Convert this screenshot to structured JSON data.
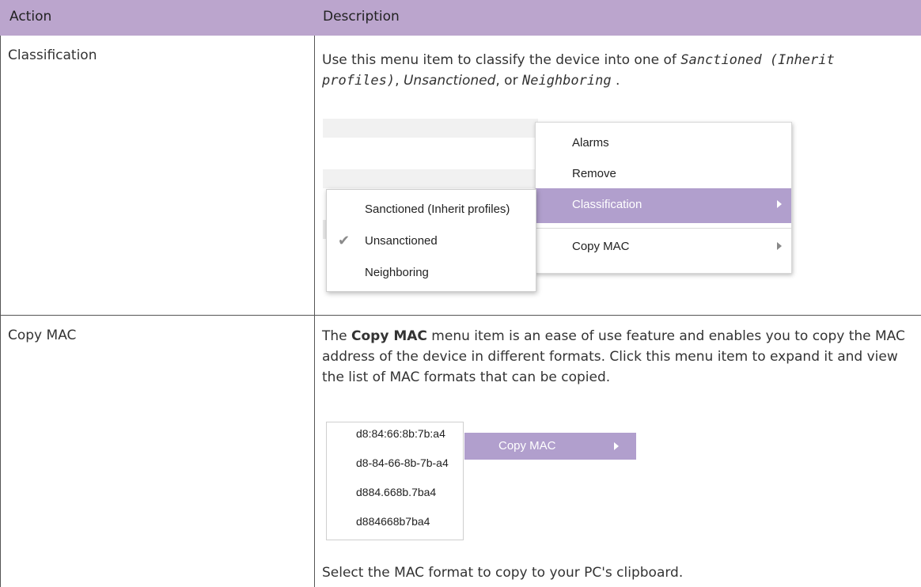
{
  "table": {
    "header": {
      "action": "Action",
      "description": "Description"
    },
    "rows": [
      {
        "action": "Classification",
        "desc_parts": {
          "pre": "Use this menu item to classify the device into one of ",
          "opt1": "Sanctioned (Inherit profiles)",
          "sep1": ", ",
          "opt2": "Unsanctioned",
          "sep2": ", or ",
          "opt3": "Neighboring",
          "end": " ."
        },
        "screenshot": {
          "menu_items": [
            "Alarms",
            "Remove",
            "Classification",
            "Copy MAC"
          ],
          "active_item": "Classification",
          "submenu_items": [
            "Sanctioned (Inherit profiles)",
            "Unsanctioned",
            "Neighboring"
          ],
          "checked_item": "Unsanctioned"
        }
      },
      {
        "action": "Copy MAC",
        "desc_parts": {
          "pre": "The ",
          "bold": "Copy MAC",
          "rest": " menu item is an ease of use feature and enables you to copy the MAC address of the device in different formats. Click this menu item to expand it and view the list of MAC formats that can be copied."
        },
        "screenshot": {
          "button_label": "Copy MAC",
          "mac_formats": [
            "d8:84:66:8b:7b:a4",
            "d8-84-66-8b-7b-a4",
            "d884.668b.7ba4",
            "d884668b7ba4"
          ]
        },
        "footer": "Select the MAC format to copy to your PC's clipboard."
      }
    ]
  },
  "colors": {
    "header_bg": "#bba5cd",
    "menu_highlight": "#b19fcd",
    "text": "#333333"
  }
}
